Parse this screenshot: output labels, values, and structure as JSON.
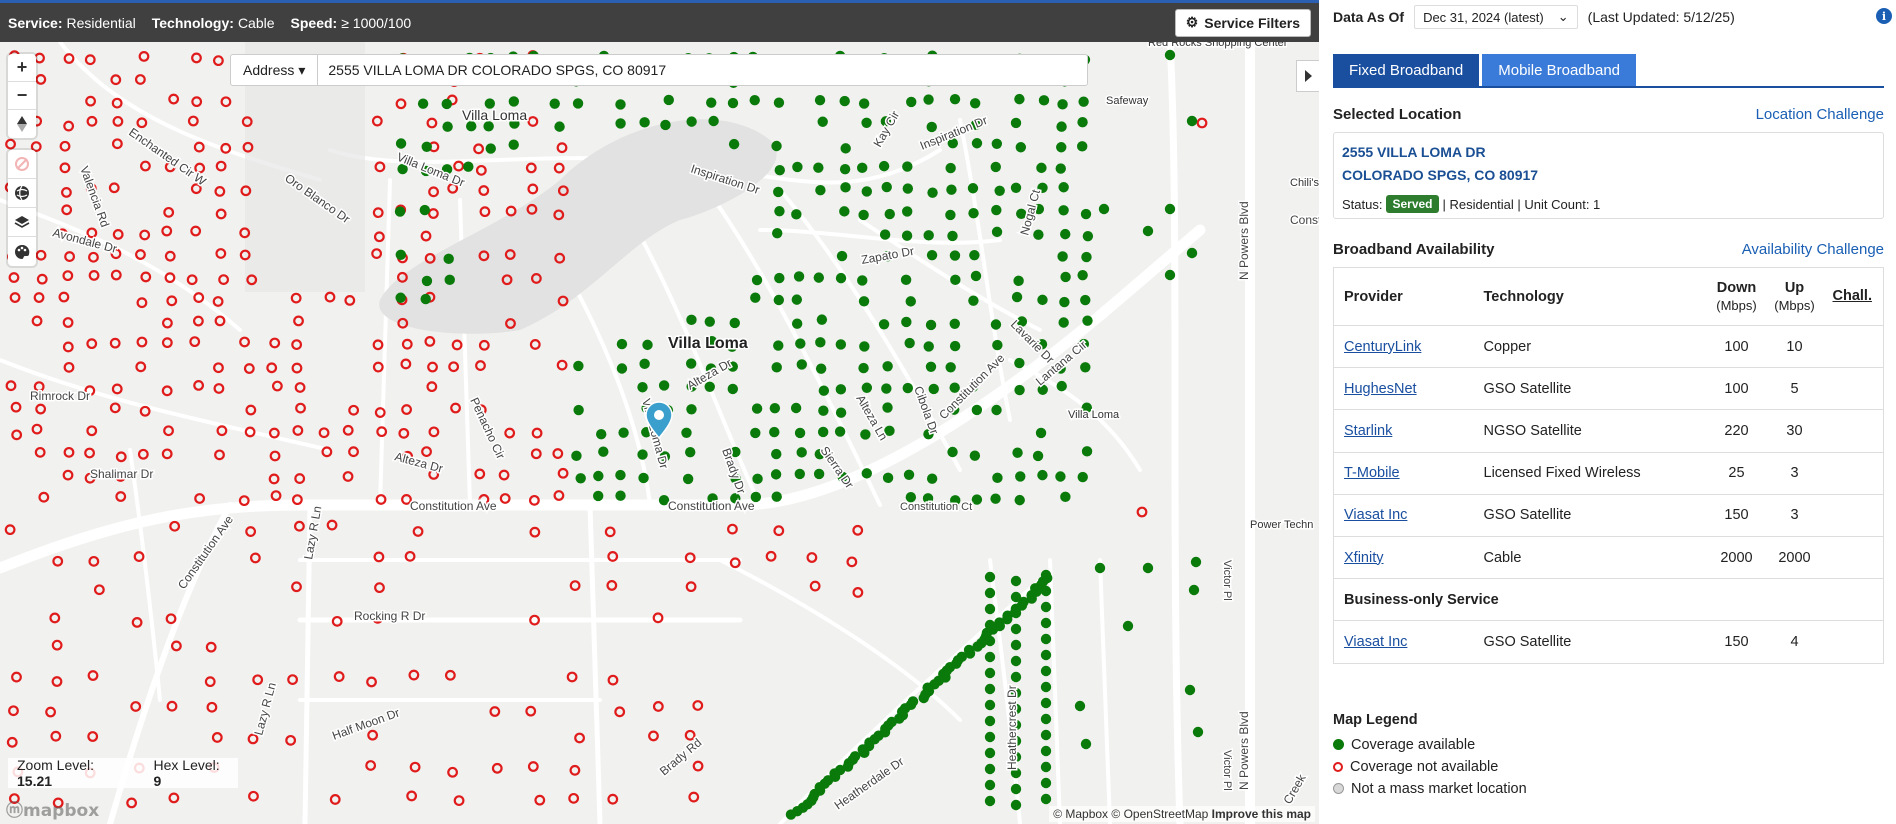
{
  "filters": {
    "service_label": "Service:",
    "service_value": "Residential",
    "technology_label": "Technology:",
    "technology_value": "Cable",
    "speed_label": "Speed:",
    "speed_value": "≥ 1000/100",
    "button_label": "Service Filters"
  },
  "search": {
    "type_label": "Address",
    "value": "2555 VILLA LOMA DR COLORADO SPGS, CO 80917"
  },
  "map": {
    "zoom_label": "Zoom Level:",
    "zoom_value": "15.21",
    "hex_label": "Hex Level:",
    "hex_value": "9",
    "logo_text": "mapbox",
    "attribution": {
      "mapbox": "© Mapbox",
      "osm": "© OpenStreetMap",
      "improve": "Improve this map"
    },
    "place_labels": [
      {
        "text": "Villa Loma"
      },
      {
        "text": "Villa Loma"
      },
      {
        "text": "Villa Loma"
      },
      {
        "text": "Red Rocks Shopping Center"
      },
      {
        "text": "Safeway"
      },
      {
        "text": "Constitution Ave"
      },
      {
        "text": "Constitution Ave"
      },
      {
        "text": "Constitution Ave"
      },
      {
        "text": "Constitution Ave"
      },
      {
        "text": "Constitution Ct"
      },
      {
        "text": "N Powers Blvd"
      },
      {
        "text": "N Powers Blvd"
      },
      {
        "text": "Victor Pl"
      },
      {
        "text": "Victor Pl"
      },
      {
        "text": "Inspiration Dr"
      },
      {
        "text": "Inspiration Dr"
      },
      {
        "text": "Villa Loma Dr"
      },
      {
        "text": "Villa Loma Dr"
      },
      {
        "text": "Alteza Dr"
      },
      {
        "text": "Alteza Dr"
      },
      {
        "text": "Alteza Ln"
      },
      {
        "text": "Zapato Dr"
      },
      {
        "text": "Cibola Dr"
      },
      {
        "text": "Sierra Dr"
      },
      {
        "text": "Brady Dr"
      },
      {
        "text": "Brady Rd"
      },
      {
        "text": "Lavarie Dr"
      },
      {
        "text": "Lantana Cir"
      },
      {
        "text": "Nogal Ct"
      },
      {
        "text": "Kay Cir"
      },
      {
        "text": "Penacho Cir"
      },
      {
        "text": "Oro Blanco Dr"
      },
      {
        "text": "Valencia Rd"
      },
      {
        "text": "Enchanted Cir W"
      },
      {
        "text": "Avondale Dr"
      },
      {
        "text": "Rimrock Dr"
      },
      {
        "text": "Shalimar Dr"
      },
      {
        "text": "Lazy R Ln"
      },
      {
        "text": "Lazy R Ln"
      },
      {
        "text": "Rocking R Dr"
      },
      {
        "text": "Half Moon Dr"
      },
      {
        "text": "Heatherdale Dr"
      },
      {
        "text": "Heathercrest Dr"
      },
      {
        "text": "Chili's"
      },
      {
        "text": "Constitu"
      },
      {
        "text": "Power Techn"
      },
      {
        "text": "Creek"
      }
    ]
  },
  "panel": {
    "data_as_of_label": "Data As Of",
    "data_as_of_value": "Dec 31, 2024 (latest)",
    "last_updated": "(Last Updated: 5/12/25)",
    "tabs": [
      {
        "label": "Fixed Broadband"
      },
      {
        "label": "Mobile Broadband"
      }
    ],
    "selected_location": {
      "title": "Selected Location",
      "challenge_link": "Location Challenge",
      "address_line1": "2555 VILLA LOMA DR",
      "address_line2": "COLORADO SPGS, CO 80917",
      "status_label": "Status:",
      "status_badge": "Served",
      "details": "| Residential | Unit Count: 1"
    },
    "availability": {
      "title": "Broadband Availability",
      "challenge_link": "Availability Challenge",
      "headers": {
        "provider": "Provider",
        "technology": "Technology",
        "down": "Down",
        "up": "Up",
        "unit": "(Mbps)",
        "chall": "Chall."
      },
      "rows": [
        {
          "provider": "CenturyLink",
          "technology": "Copper",
          "down": "100",
          "up": "10"
        },
        {
          "provider": "HughesNet",
          "technology": "GSO Satellite",
          "down": "100",
          "up": "5"
        },
        {
          "provider": "Starlink",
          "technology": "NGSO Satellite",
          "down": "220",
          "up": "30"
        },
        {
          "provider": "T-Mobile",
          "technology": "Licensed Fixed Wireless",
          "down": "25",
          "up": "3"
        },
        {
          "provider": "Viasat Inc",
          "technology": "GSO Satellite",
          "down": "150",
          "up": "3"
        },
        {
          "provider": "Xfinity",
          "technology": "Cable",
          "down": "2000",
          "up": "2000"
        }
      ],
      "business_title": "Business-only Service",
      "business_rows": [
        {
          "provider": "Viasat Inc",
          "technology": "GSO Satellite",
          "down": "150",
          "up": "4"
        }
      ]
    },
    "legend": {
      "title": "Map Legend",
      "items": [
        {
          "label": "Coverage available",
          "color": "#0a7a0a"
        },
        {
          "label": "Coverage not available",
          "color": "#e01b1b"
        },
        {
          "label": "Not a mass market location",
          "color": "#bdbdbd"
        }
      ]
    }
  },
  "colors": {
    "tab_active": "#1a4fa0",
    "tab_inactive": "#3a7ad8",
    "served": "#2e7d2e",
    "covered": "#0a7a0a",
    "not_covered": "#e01b1b"
  }
}
